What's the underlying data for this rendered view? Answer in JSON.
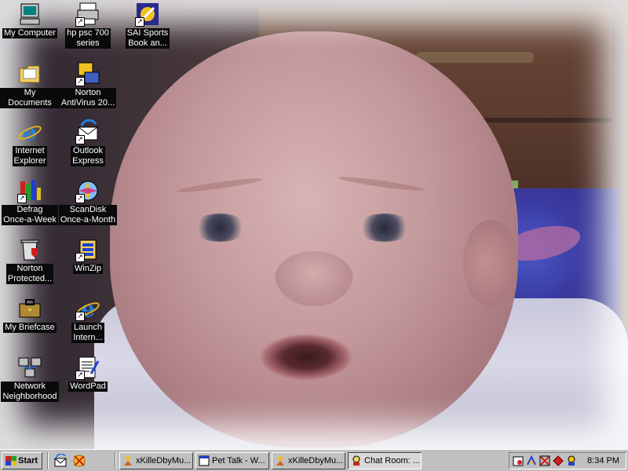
{
  "desktop": {
    "icons": [
      {
        "label_line1": "My Computer",
        "label_line2": "",
        "icon": "computer-icon",
        "shortcut": false
      },
      {
        "label_line1": "hp psc 700",
        "label_line2": "series",
        "icon": "printer-icon",
        "shortcut": true
      },
      {
        "label_line1": "SAI Sports",
        "label_line2": "Book an...",
        "icon": "sportsbook-icon",
        "shortcut": true
      },
      {
        "label_line1": "My Documents",
        "label_line2": "",
        "icon": "folder-icon",
        "shortcut": false
      },
      {
        "label_line1": "Norton",
        "label_line2": "AntiVirus 20...",
        "icon": "norton-antivirus-icon",
        "shortcut": true
      },
      {
        "label_line1": "Internet",
        "label_line2": "Explorer",
        "icon": "internet-explorer-icon",
        "shortcut": false
      },
      {
        "label_line1": "Outlook",
        "label_line2": "Express",
        "icon": "outlook-express-icon",
        "shortcut": true
      },
      {
        "label_line1": "Defrag",
        "label_line2": "Once-a-Week",
        "icon": "defrag-icon",
        "shortcut": true
      },
      {
        "label_line1": "ScanDisk",
        "label_line2": "Once-a-Month",
        "icon": "scandisk-icon",
        "shortcut": true
      },
      {
        "label_line1": "Norton",
        "label_line2": "Protected...",
        "icon": "recycle-bin-icon",
        "shortcut": false
      },
      {
        "label_line1": "WinZip",
        "label_line2": "",
        "icon": "winzip-icon",
        "shortcut": true
      },
      {
        "label_line1": "My Briefcase",
        "label_line2": "",
        "icon": "briefcase-icon",
        "shortcut": false
      },
      {
        "label_line1": "Launch",
        "label_line2": "Intern...",
        "icon": "internet-explorer-icon",
        "shortcut": true
      },
      {
        "label_line1": "Network",
        "label_line2": "Neighborhood",
        "icon": "network-icon",
        "shortcut": false
      },
      {
        "label_line1": "WordPad",
        "label_line2": "",
        "icon": "wordpad-icon",
        "shortcut": true
      }
    ]
  },
  "taskbar": {
    "start_label": "Start",
    "quick_launch": [
      "outlook-express-icon",
      "media-icon"
    ],
    "tasks": [
      {
        "label": "xKilleDbyMu...",
        "icon": "user-icon",
        "active": false
      },
      {
        "label": "Pet Talk - W...",
        "icon": "document-icon",
        "active": false
      },
      {
        "label": "xKilleDbyMu...",
        "icon": "user-icon",
        "active": false
      },
      {
        "label": "Chat Room: ...",
        "icon": "chat-icon",
        "active": true
      }
    ],
    "tray_icons": [
      "scheduler-icon",
      "aol-icon",
      "network-status-icon",
      "shield-icon",
      "messenger-icon"
    ],
    "clock": "8:34 PM"
  }
}
